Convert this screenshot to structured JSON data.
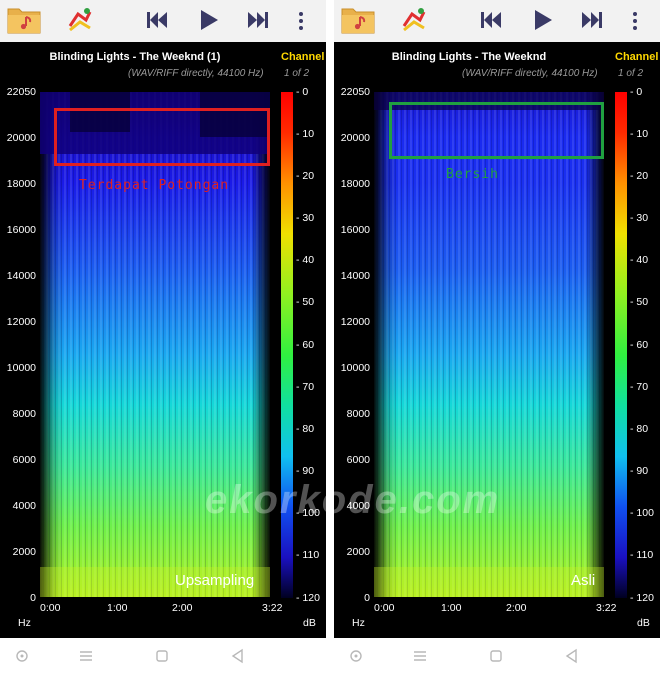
{
  "screens": [
    {
      "title": "Blinding Lights - The Weeknd (1)",
      "channel_label": "Channel",
      "subtitle": "(WAV/RIFF directly, 44100 Hz)",
      "page_indicator": "1 of 2",
      "annotation_text": "Terdapat Potongan",
      "annotation_color": "#e02020",
      "corner_label": "Upsampling",
      "band_cut": true
    },
    {
      "title": "Blinding Lights - The Weeknd",
      "channel_label": "Channel",
      "subtitle": "(WAV/RIFF directly, 44100 Hz)",
      "page_indicator": "1 of 2",
      "annotation_text": "Bersih",
      "annotation_color": "#20a040",
      "corner_label": "Asli",
      "band_cut": false
    }
  ],
  "axis": {
    "y_ticks": [
      "22050",
      "20000",
      "18000",
      "16000",
      "14000",
      "12000",
      "10000",
      "8000",
      "6000",
      "4000",
      "2000",
      "0"
    ],
    "y_unit": "Hz",
    "x_ticks": [
      "0:00",
      "1:00",
      "2:00",
      "3:22"
    ],
    "db_ticks": [
      "- 0",
      "- 10",
      "- 20",
      "- 30",
      "- 40",
      "- 50",
      "- 60",
      "- 70",
      "- 80",
      "- 90",
      "- 100",
      "- 110",
      "- 120"
    ],
    "db_unit": "dB"
  },
  "watermark": "ekorkode.com",
  "icons": {
    "toolbar": [
      "folder-music-icon",
      "app-logo-icon",
      "skip-back-icon",
      "play-icon",
      "skip-forward-icon",
      "more-vert-icon"
    ],
    "navbar": [
      "circle-nav-icon",
      "menu-nav-icon",
      "square-nav-icon",
      "back-nav-icon"
    ]
  },
  "colors": {
    "toolbar_bg": "#f2f2f2",
    "toolbar_icon": "#3a3a66",
    "channel": "#ffd800",
    "background": "#000000"
  }
}
